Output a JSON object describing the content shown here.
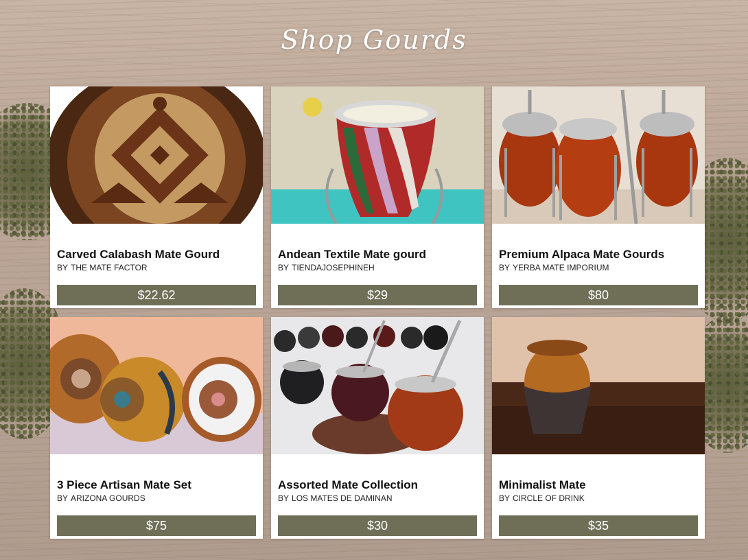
{
  "page": {
    "title": "Shop Gourds"
  },
  "seller_prefix": "BY",
  "products": [
    {
      "title": "Carved Calabash Mate Gourd",
      "seller": "THE MATE FACTOR",
      "price": "$22.62",
      "image_icon": "carved-gourd-photo"
    },
    {
      "title": "Andean Textile Mate gourd",
      "seller": "TIENDAJOSEPHINEH",
      "price": "$29",
      "image_icon": "textile-gourd-photo"
    },
    {
      "title": "Premium Alpaca Mate Gourds",
      "seller": "YERBA MATE IMPORIUM",
      "price": "$80",
      "image_icon": "alpaca-gourds-photo"
    },
    {
      "title": "3 Piece Artisan Mate Set",
      "seller": "ARIZONA GOURDS",
      "price": "$75",
      "image_icon": "artisan-set-photo"
    },
    {
      "title": "Assorted Mate Collection",
      "seller": "LOS MATES DE DAMINAN",
      "price": "$30",
      "image_icon": "assorted-collection-photo"
    },
    {
      "title": "Minimalist Mate",
      "seller": "CIRCLE OF DRINK",
      "price": "$35",
      "image_icon": "minimalist-mate-photo"
    }
  ],
  "colors": {
    "price_button": "#6f6f58",
    "card_background": "#ffffff",
    "title_text": "#ffffff"
  }
}
